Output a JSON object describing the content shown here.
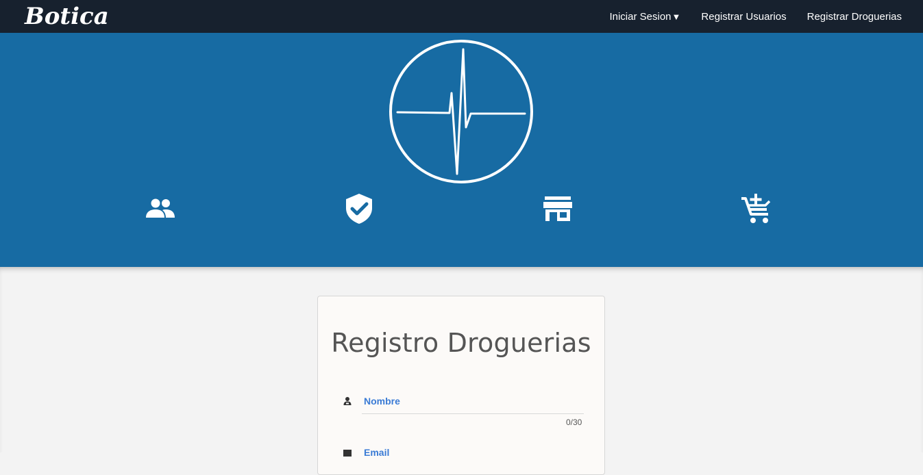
{
  "brand": {
    "name": "Botica"
  },
  "nav": {
    "login_label": "Iniciar Sesion",
    "login_caret": "▼",
    "register_users_label": "Registrar Usuarios",
    "register_drugstores_label": "Registrar Droguerias"
  },
  "hero": {
    "background": "#176ba3",
    "icons": [
      "users-icon",
      "shield-check-icon",
      "store-icon",
      "cart-add-icon"
    ]
  },
  "form": {
    "title": "Registro Droguerias",
    "fields": [
      {
        "label": "Nombre",
        "icon": "person-icon",
        "counter": "0/30"
      },
      {
        "label": "Email",
        "icon": "email-icon"
      }
    ]
  },
  "colors": {
    "navbar": "#17212e",
    "accent_label": "#3a7bd5"
  }
}
